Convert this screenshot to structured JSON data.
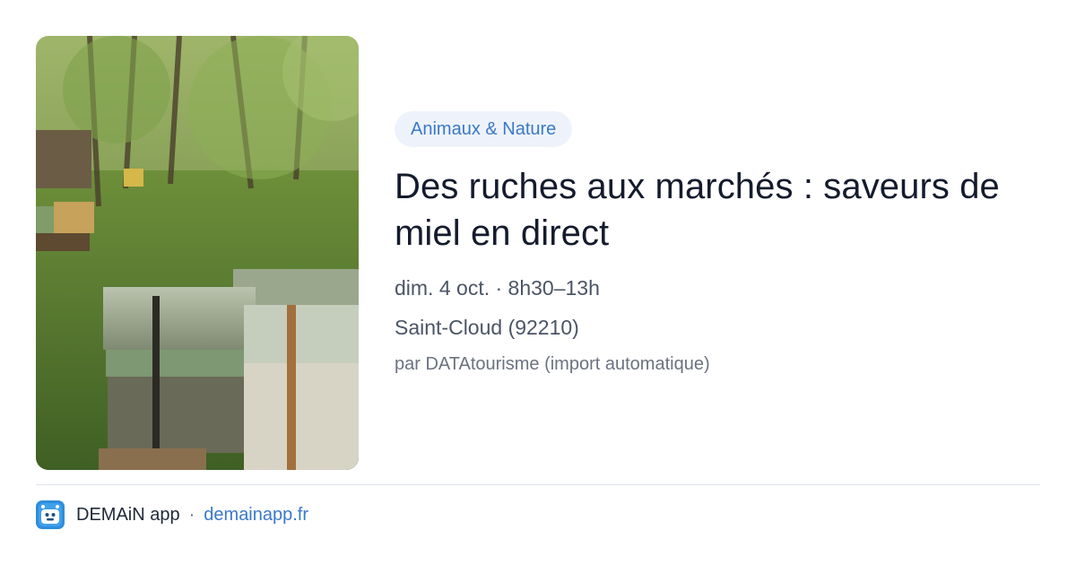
{
  "event": {
    "category": "Animaux & Nature",
    "title": "Des ruches aux marchés : saveurs de miel en direct",
    "datetime": "dim. 4 oct. · 8h30–13h",
    "location": "Saint-Cloud (92210)",
    "source": "par DATAtourisme (import automatique)"
  },
  "footer": {
    "app_name": "DEMAiN app",
    "separator": "·",
    "url": "demainapp.fr"
  },
  "icons": {
    "app": "demain-logo-icon"
  },
  "colors": {
    "accent": "#3b78c9",
    "chip_bg": "#eef3fb",
    "title": "#141b2d",
    "meta": "#4b5565",
    "source": "#6b7280",
    "divider": "#dde3ea"
  }
}
